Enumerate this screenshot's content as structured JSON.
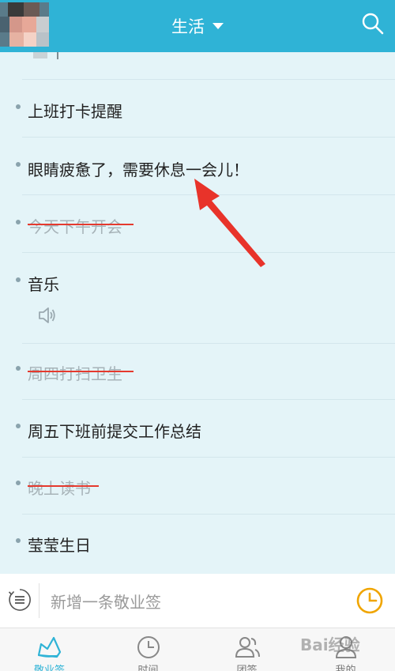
{
  "header": {
    "title": "生活",
    "bg_color": "#2fb3d6"
  },
  "notes": [
    {
      "text": "上班打卡提醒",
      "done": false
    },
    {
      "text": "眼睛疲惫了，需要休息一会儿！",
      "done": false
    },
    {
      "text": "今天下午开会",
      "done": true
    },
    {
      "text": "音乐",
      "done": false,
      "has_audio": true
    },
    {
      "text": "周四打扫卫生",
      "done": true
    },
    {
      "text": "周五下班前提交工作总结",
      "done": false
    },
    {
      "text": "晚上读书",
      "done": true
    },
    {
      "text": "莹莹生日",
      "done": false
    }
  ],
  "input": {
    "placeholder": "新增一条敬业签"
  },
  "tabs": [
    {
      "label": "敬业签",
      "icon": "note-icon",
      "active": true
    },
    {
      "label": "时间",
      "icon": "clock-icon",
      "active": false
    },
    {
      "label": "团签",
      "icon": "group-icon",
      "active": false
    },
    {
      "label": "我的",
      "icon": "profile-icon",
      "active": false
    }
  ],
  "watermark": "Bai经验",
  "colors": {
    "accent": "#2fb3d6",
    "strike": "#e53a2e",
    "clock": "#f0a500",
    "arrow": "#e8332a"
  }
}
